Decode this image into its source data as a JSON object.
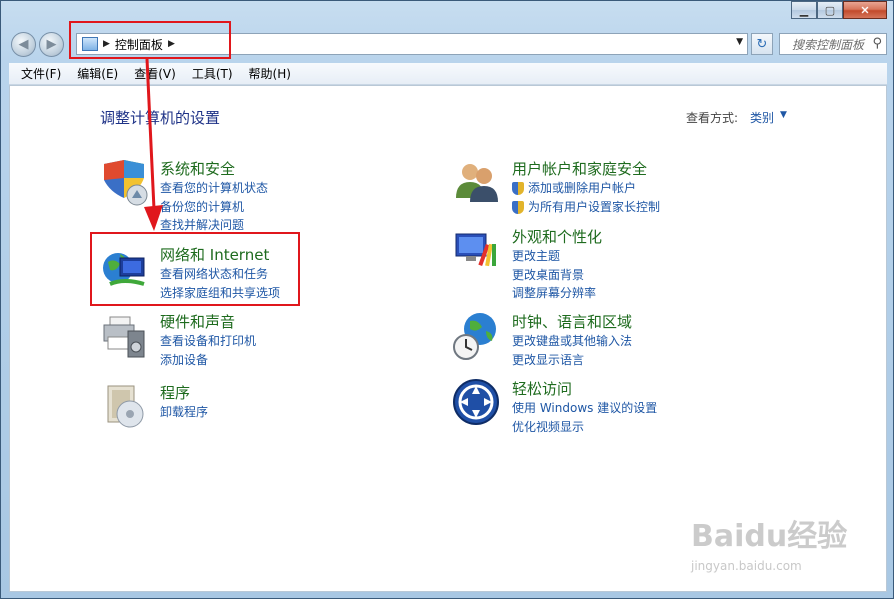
{
  "window": {
    "caption": {
      "minimize": "▁",
      "maximize": "▢",
      "close": "✕"
    }
  },
  "nav": {
    "back_glyph": "◀",
    "forward_glyph": "▶",
    "breadcrumb": "控制面板",
    "refresh_glyph": "↻",
    "search_placeholder": "搜索控制面板",
    "search_icon": "magnifier-icon"
  },
  "menubar": {
    "items": [
      "文件(F)",
      "编辑(E)",
      "查看(V)",
      "工具(T)",
      "帮助(H)"
    ]
  },
  "main": {
    "title": "调整计算机的设置",
    "view_by_label": "查看方式:",
    "view_by_value": "类别"
  },
  "categories": {
    "security": {
      "title": "系统和安全",
      "links": [
        "查看您的计算机状态",
        "备份您的计算机",
        "查找并解决问题"
      ],
      "icon": "shield-icon"
    },
    "network": {
      "title": "网络和 Internet",
      "links": [
        "查看网络状态和任务",
        "选择家庭组和共享选项"
      ],
      "icon": "network-globe-icon"
    },
    "hardware": {
      "title": "硬件和声音",
      "links": [
        "查看设备和打印机",
        "添加设备"
      ],
      "icon": "printer-icon"
    },
    "programs": {
      "title": "程序",
      "links": [
        "卸载程序"
      ],
      "icon": "programs-icon"
    },
    "users": {
      "title": "用户帐户和家庭安全",
      "links": [
        "添加或删除用户帐户",
        "为所有用户设置家长控制"
      ],
      "icon": "users-icon"
    },
    "appearance": {
      "title": "外观和个性化",
      "links": [
        "更改主题",
        "更改桌面背景",
        "调整屏幕分辨率"
      ],
      "icon": "monitor-palette-icon"
    },
    "clock": {
      "title": "时钟、语言和区域",
      "links": [
        "更改键盘或其他输入法",
        "更改显示语言"
      ],
      "icon": "clock-globe-icon"
    },
    "ease": {
      "title": "轻松访问",
      "links": [
        "使用 Windows 建议的设置",
        "优化视频显示"
      ],
      "icon": "ease-of-access-icon"
    }
  },
  "watermark": {
    "brand": "Baidu经验",
    "url": "jingyan.baidu.com"
  },
  "colors": {
    "link": "#1f57a5",
    "category_title": "#1e6b1e",
    "page_title": "#1e3287",
    "annotation": "#e0171c"
  }
}
